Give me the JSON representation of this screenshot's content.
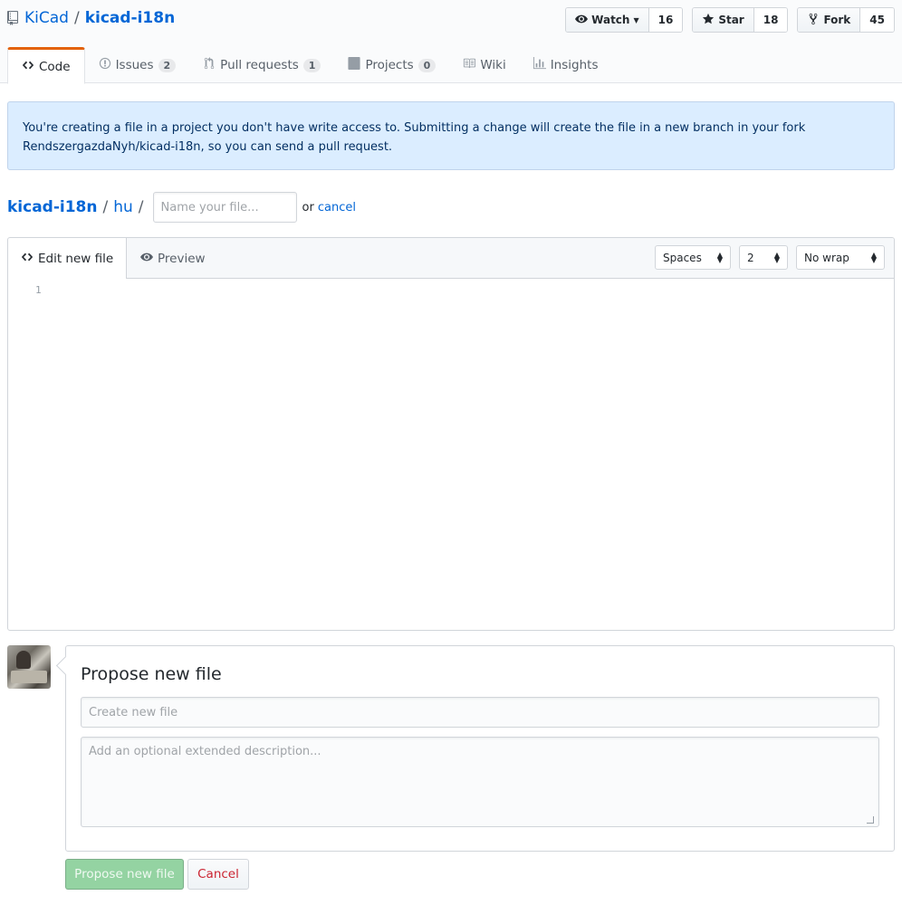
{
  "repo": {
    "owner": "KiCad",
    "separator": "/",
    "name": "kicad-i18n"
  },
  "actions": {
    "watch": {
      "label": "Watch",
      "count": "16"
    },
    "star": {
      "label": "Star",
      "count": "18"
    },
    "fork": {
      "label": "Fork",
      "count": "45"
    }
  },
  "tabs": [
    {
      "label": "Code",
      "icon": "code-icon"
    },
    {
      "label": "Issues",
      "count": "2",
      "icon": "issue-icon"
    },
    {
      "label": "Pull requests",
      "count": "1",
      "icon": "pull-request-icon"
    },
    {
      "label": "Projects",
      "count": "0",
      "icon": "project-icon"
    },
    {
      "label": "Wiki",
      "icon": "book-icon"
    },
    {
      "label": "Insights",
      "icon": "graph-icon"
    }
  ],
  "flash": {
    "line1": "You're creating a file in a project you don't have write access to. Submitting a change will create the file in a new branch in your fork",
    "line2": "RendszergazdaNyh/kicad-i18n, so you can send a pull request."
  },
  "breadcrumb": {
    "root": "kicad-i18n",
    "sep": "/",
    "folder": "hu",
    "filename_placeholder": "Name your file...",
    "or_text": "or",
    "cancel": "cancel"
  },
  "editor": {
    "edit_tab": "Edit new file",
    "preview_tab": "Preview",
    "indent_mode": "Spaces",
    "indent_size": "2",
    "wrap_mode": "No wrap",
    "line_number": "1"
  },
  "commit": {
    "title": "Propose new file",
    "summary_placeholder": "Create new file",
    "description_placeholder": "Add an optional extended description...",
    "submit_label": "Propose new file",
    "cancel_label": "Cancel"
  },
  "colors": {
    "accent": "#e36209",
    "link": "#0366d6",
    "flash_bg": "#dbedff",
    "primary_disabled": "#94d3a2",
    "danger": "#cb2431"
  }
}
